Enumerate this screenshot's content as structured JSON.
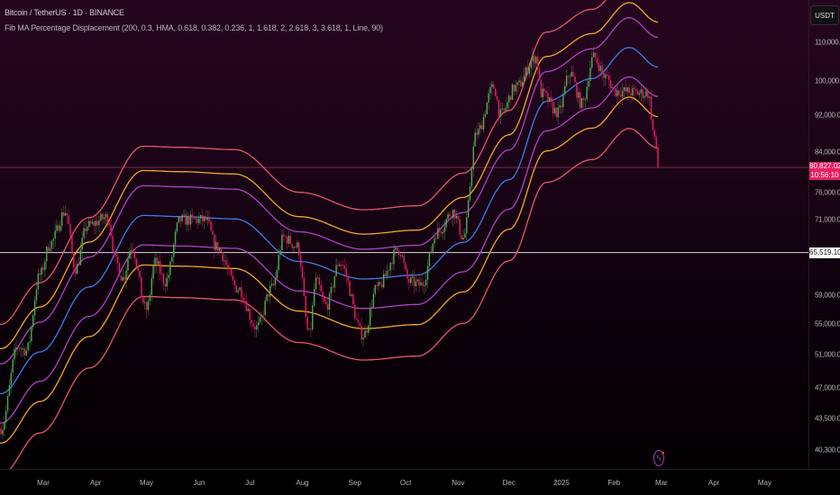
{
  "header": {
    "symbol_line": "Bitcoin / TetherUS · 1D · BINANCE",
    "indicator_line": "Fib MA Percentage Displacement (200, 0.3, HMA, 0.618, 0.382, 0.236, 1, 1.618, 2, 2.618, 3, 3.618, 1, Line, 90)"
  },
  "price_axis": {
    "currency_button": "USDT",
    "labels": [
      "110,000.00",
      "100,000.00",
      "92,000.00",
      "84,000.00",
      "76,000.00",
      "71,000.00",
      "59,000.00",
      "55,000.00",
      "51,000.00",
      "47,000.00",
      "43,500.00",
      "40,300.00"
    ],
    "label_values": [
      110000,
      100000,
      92000,
      84000,
      76000,
      71000,
      59000,
      55000,
      51000,
      47000,
      43500,
      40300
    ],
    "current_price": "80,827.02",
    "countdown": "10:56:10",
    "reference_price": "65,519.10",
    "reference_value": 65519.1,
    "current_value": 80827.02
  },
  "time_axis": {
    "labels": [
      "Mar",
      "Apr",
      "May",
      "Jun",
      "Jul",
      "Aug",
      "Sep",
      "Oct",
      "Nov",
      "Dec",
      "2025",
      "Feb",
      "Mar",
      "Apr",
      "May"
    ],
    "dates": [
      "2024-03-01",
      "2024-04-01",
      "2024-05-01",
      "2024-06-01",
      "2024-07-01",
      "2024-08-01",
      "2024-09-01",
      "2024-10-01",
      "2024-11-01",
      "2024-12-01",
      "2025-01-01",
      "2025-02-01",
      "2025-03-01",
      "2025-04-01",
      "2025-05-01"
    ]
  },
  "colors": {
    "up": "#4caf50",
    "down": "#e91e63",
    "band_outer": "#e8556e",
    "band_orange": "#f5a623",
    "band_purple": "#b042c8",
    "center": "#3f7ae8"
  },
  "chart_data": {
    "type": "candlestick",
    "scale": "log",
    "ylim": [
      40300,
      110000
    ],
    "close_keypoints": [
      [
        "2024-02-05",
        42500
      ],
      [
        "2024-02-15",
        52000
      ],
      [
        "2024-02-20",
        51500
      ],
      [
        "2024-02-28",
        62000
      ],
      [
        "2024-03-05",
        67000
      ],
      [
        "2024-03-14",
        72500
      ],
      [
        "2024-03-20",
        63000
      ],
      [
        "2024-03-27",
        70000
      ],
      [
        "2024-04-08",
        71500
      ],
      [
        "2024-04-13",
        64000
      ],
      [
        "2024-04-17",
        61500
      ],
      [
        "2024-04-22",
        66500
      ],
      [
        "2024-05-01",
        57000
      ],
      [
        "2024-05-06",
        64000
      ],
      [
        "2024-05-12",
        61000
      ],
      [
        "2024-05-21",
        71000
      ],
      [
        "2024-06-05",
        71000
      ],
      [
        "2024-06-11",
        66500
      ],
      [
        "2024-06-24",
        60000
      ],
      [
        "2024-07-05",
        54500
      ],
      [
        "2024-07-14",
        60000
      ],
      [
        "2024-07-21",
        68000
      ],
      [
        "2024-07-29",
        66500
      ],
      [
        "2024-08-05",
        53500
      ],
      [
        "2024-08-09",
        61000
      ],
      [
        "2024-08-15",
        57500
      ],
      [
        "2024-08-23",
        64000
      ],
      [
        "2024-09-06",
        53500
      ],
      [
        "2024-09-14",
        60000
      ],
      [
        "2024-09-27",
        66000
      ],
      [
        "2024-10-03",
        61000
      ],
      [
        "2024-10-10",
        60500
      ],
      [
        "2024-10-20",
        69000
      ],
      [
        "2024-10-29",
        72500
      ],
      [
        "2024-11-04",
        68000
      ],
      [
        "2024-11-12",
        88000
      ],
      [
        "2024-11-22",
        98500
      ],
      [
        "2024-11-26",
        92000
      ],
      [
        "2024-12-05",
        98500
      ],
      [
        "2024-12-17",
        106000
      ],
      [
        "2024-12-20",
        97000
      ],
      [
        "2024-12-30",
        92500
      ],
      [
        "2025-01-06",
        102000
      ],
      [
        "2025-01-13",
        94500
      ],
      [
        "2025-01-20",
        106000
      ],
      [
        "2025-01-27",
        101000
      ],
      [
        "2025-02-02",
        97500
      ],
      [
        "2025-02-21",
        97000
      ],
      [
        "2025-02-25",
        87000
      ],
      [
        "2025-02-27",
        80827
      ]
    ],
    "center_ma_keypoints": [
      [
        "2024-02-05",
        46300
      ],
      [
        "2024-02-28",
        51300
      ],
      [
        "2024-03-28",
        60200
      ],
      [
        "2024-04-29",
        71800
      ],
      [
        "2024-05-21",
        71600
      ],
      [
        "2024-06-22",
        71200
      ],
      [
        "2024-07-30",
        64100
      ],
      [
        "2024-09-06",
        61400
      ],
      [
        "2024-10-08",
        62000
      ],
      [
        "2024-11-04",
        67200
      ],
      [
        "2024-12-01",
        78400
      ],
      [
        "2024-12-23",
        95100
      ],
      [
        "2025-01-19",
        100600
      ],
      [
        "2025-02-10",
        108600
      ],
      [
        "2025-02-27",
        103500
      ]
    ],
    "band_multipliers": {
      "upper_outer": 1.186,
      "upper_orange": 1.117,
      "upper_purple": 1.076,
      "lower_purple": 0.93,
      "lower_orange": 0.885,
      "lower_outer": 0.819
    }
  }
}
